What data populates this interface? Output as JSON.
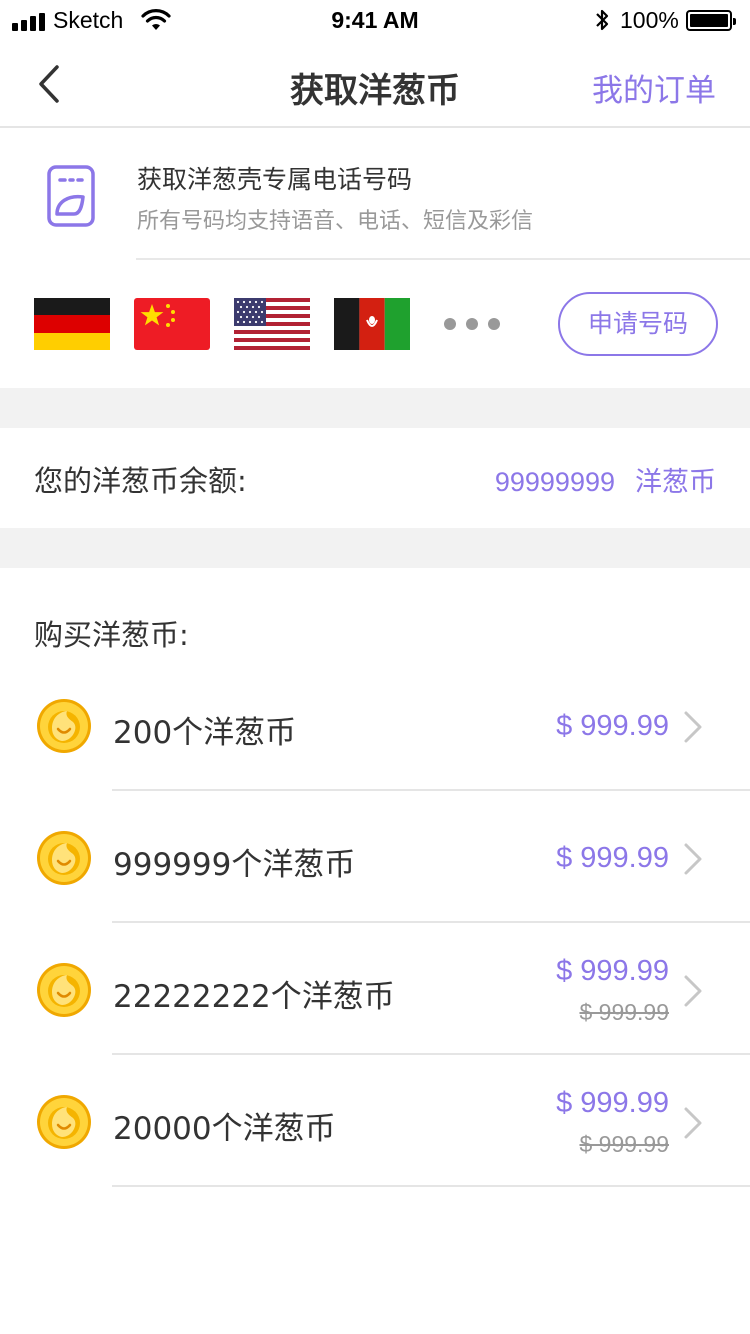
{
  "status_bar": {
    "carrier": "Sketch",
    "time": "9:41 AM",
    "battery_percent": "100%",
    "icons": [
      "signal-icon",
      "wifi-icon",
      "bluetooth-icon",
      "battery-icon"
    ]
  },
  "nav": {
    "title": "获取洋葱币",
    "right_action": "我的订单",
    "back_icon": "chevron-left-icon"
  },
  "number_section": {
    "title": "获取洋葱壳专属电话号码",
    "subtitle": "所有号码均支持语音、电话、短信及彩信",
    "icon": "sim-card-icon",
    "flags": [
      "germany-flag",
      "china-flag",
      "usa-flag",
      "afghanistan-flag"
    ],
    "more_icon": "more-dots-icon",
    "apply_button": "申请号码"
  },
  "balance": {
    "label": "您的洋葱币余额:",
    "amount": "99999999",
    "unit": "洋葱币"
  },
  "purchase": {
    "title": "购买洋葱币:",
    "items": [
      {
        "label": "200个洋葱币",
        "price": "$ 999.99",
        "original_price": ""
      },
      {
        "label": "999999个洋葱币",
        "price": "$ 999.99",
        "original_price": ""
      },
      {
        "label": "22222222个洋葱币",
        "price": "$ 999.99",
        "original_price": "$ 999.99"
      },
      {
        "label": "20000个洋葱币",
        "price": "$ 999.99",
        "original_price": "$ 999.99"
      }
    ]
  },
  "colors": {
    "accent": "#8c77e8",
    "text": "#333333",
    "secondary_text": "#999999",
    "section_gap": "#f2f2f2",
    "coin": "#f5c518"
  }
}
